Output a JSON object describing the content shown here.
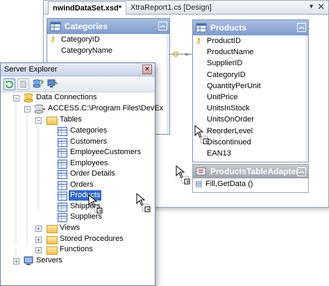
{
  "designer": {
    "tabs": [
      {
        "label": "nwindDataSet.xsd*",
        "active": true
      },
      {
        "label": "XtraReport1.cs [Design]",
        "active": false
      }
    ],
    "categories_table": {
      "title": "Categories",
      "fields": [
        "CategoryID",
        "CategoryName"
      ],
      "key_field": "CategoryID"
    },
    "products_table": {
      "title": "Products",
      "fields": [
        "ProductID",
        "ProductName",
        "SupplierID",
        "CategoryID",
        "QuantityPerUnit",
        "UnitPrice",
        "UnitsInStock",
        "UnitsOnOrder",
        "ReorderLevel",
        "Discontinued",
        "EAN13"
      ],
      "key_field": "ProductID"
    },
    "products_adapter": {
      "title": "ProductsTableAdapter",
      "method": "Fill,GetData ()"
    }
  },
  "server_explorer": {
    "title": "Server Explorer",
    "toolbar_icons": [
      "refresh-icon",
      "stop-icon",
      "connect-database-icon",
      "connect-server-icon"
    ],
    "tree": {
      "data_connections": "Data Connections",
      "connection": "ACCESS.C:\\Program Files\\DevEx",
      "tables_folder": "Tables",
      "tables": [
        "Categories",
        "Customers",
        "EmployeeCustomers",
        "Employees",
        "Order Details",
        "Orders",
        "Products",
        "Shippers",
        "Suppliers"
      ],
      "selected_table": "Products",
      "views": "Views",
      "stored_procedures": "Stored Procedures",
      "functions": "Functions",
      "servers": "Servers"
    }
  },
  "colors": {
    "table_header": "#8fa8d6",
    "selection": "#3169c6",
    "adapter_header": "#a4aab4"
  }
}
